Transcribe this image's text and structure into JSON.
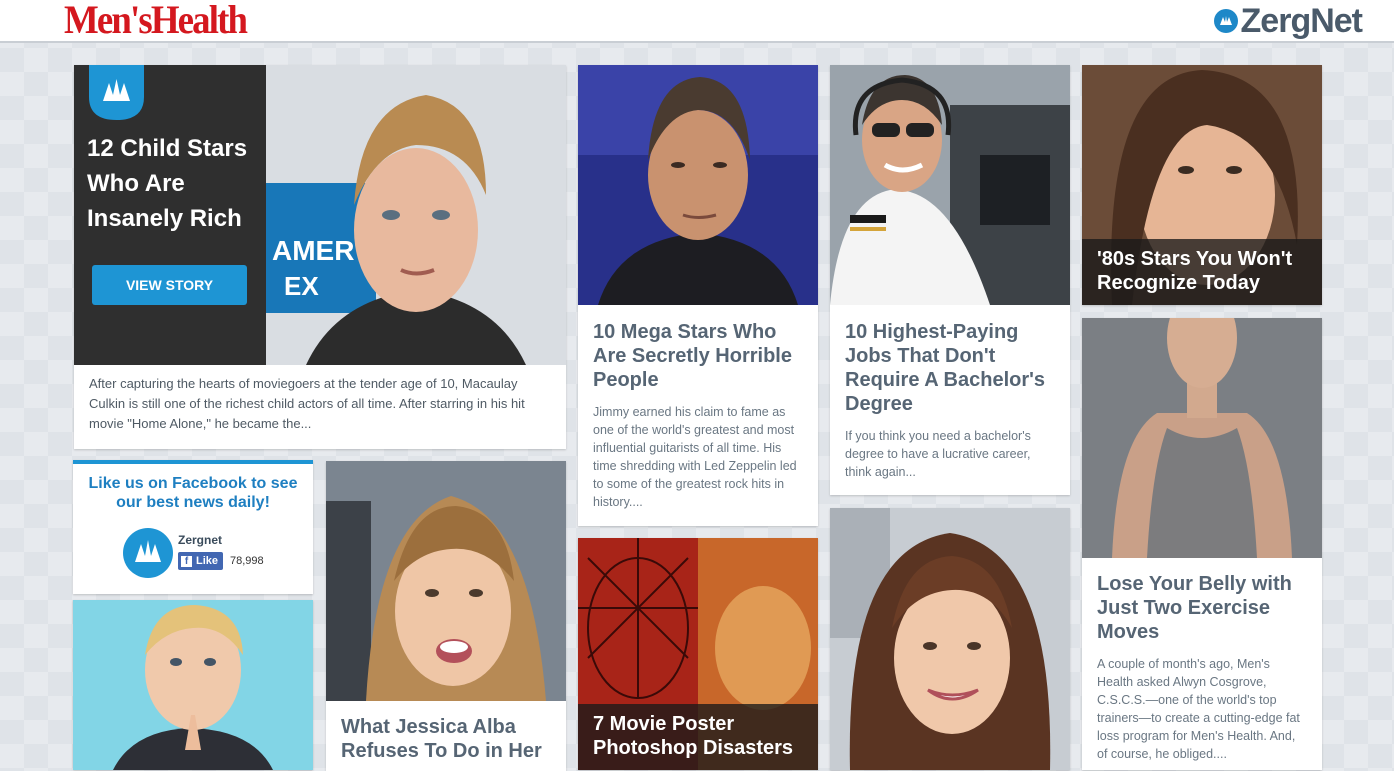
{
  "header": {
    "brand": "Men'sHealth",
    "partner": "ZergNet"
  },
  "featured": {
    "title": "12 Child Stars Who Are Insanely Rich",
    "button": "VIEW STORY",
    "description": "After capturing the hearts of moviegoers at the tender age of 10, Macaulay Culkin is still one of the richest child actors of all time. After starring in his hit movie \"Home Alone,\" he became the...",
    "sign_text": "AMER EX"
  },
  "facebook": {
    "headline": "Like us on Facebook to see our best news daily!",
    "page_name": "Zergnet",
    "like_label": "Like",
    "like_count": "78,998"
  },
  "cards": {
    "sean": {
      "title": "10 Mega Stars Who Are Secretly Horrible People",
      "description": "Jimmy earned his claim to fame as one of the world's greatest and most influential guitarists of all time. His time shredding with Led Zeppelin led to some of the greatest rock hits in history...."
    },
    "pilot": {
      "title": "10 Highest-Paying Jobs That Don't Require A Bachelor's Degree",
      "description": "If you think you need a bachelor's degree to have a lucrative career, think again..."
    },
    "eighties": {
      "title": "'80s Stars You Won't Recognize Today"
    },
    "belly": {
      "title": "Lose Your Belly with Just Two Exercise Moves",
      "description": "A couple of month's ago, Men's Health asked Alwyn Cosgrove, C.S.C.S.—one of the world's top trainers—to create a cutting-edge fat loss program for Men's Health. And, of course, he obliged...."
    },
    "jessica": {
      "title": "What Jessica Alba Refuses To Do in Her"
    },
    "poster": {
      "title": "7 Movie Poster Photoshop Disasters"
    }
  },
  "colors": {
    "accent": "#1e95d4",
    "brand_red": "#d4181f",
    "title_gray": "#566574"
  }
}
